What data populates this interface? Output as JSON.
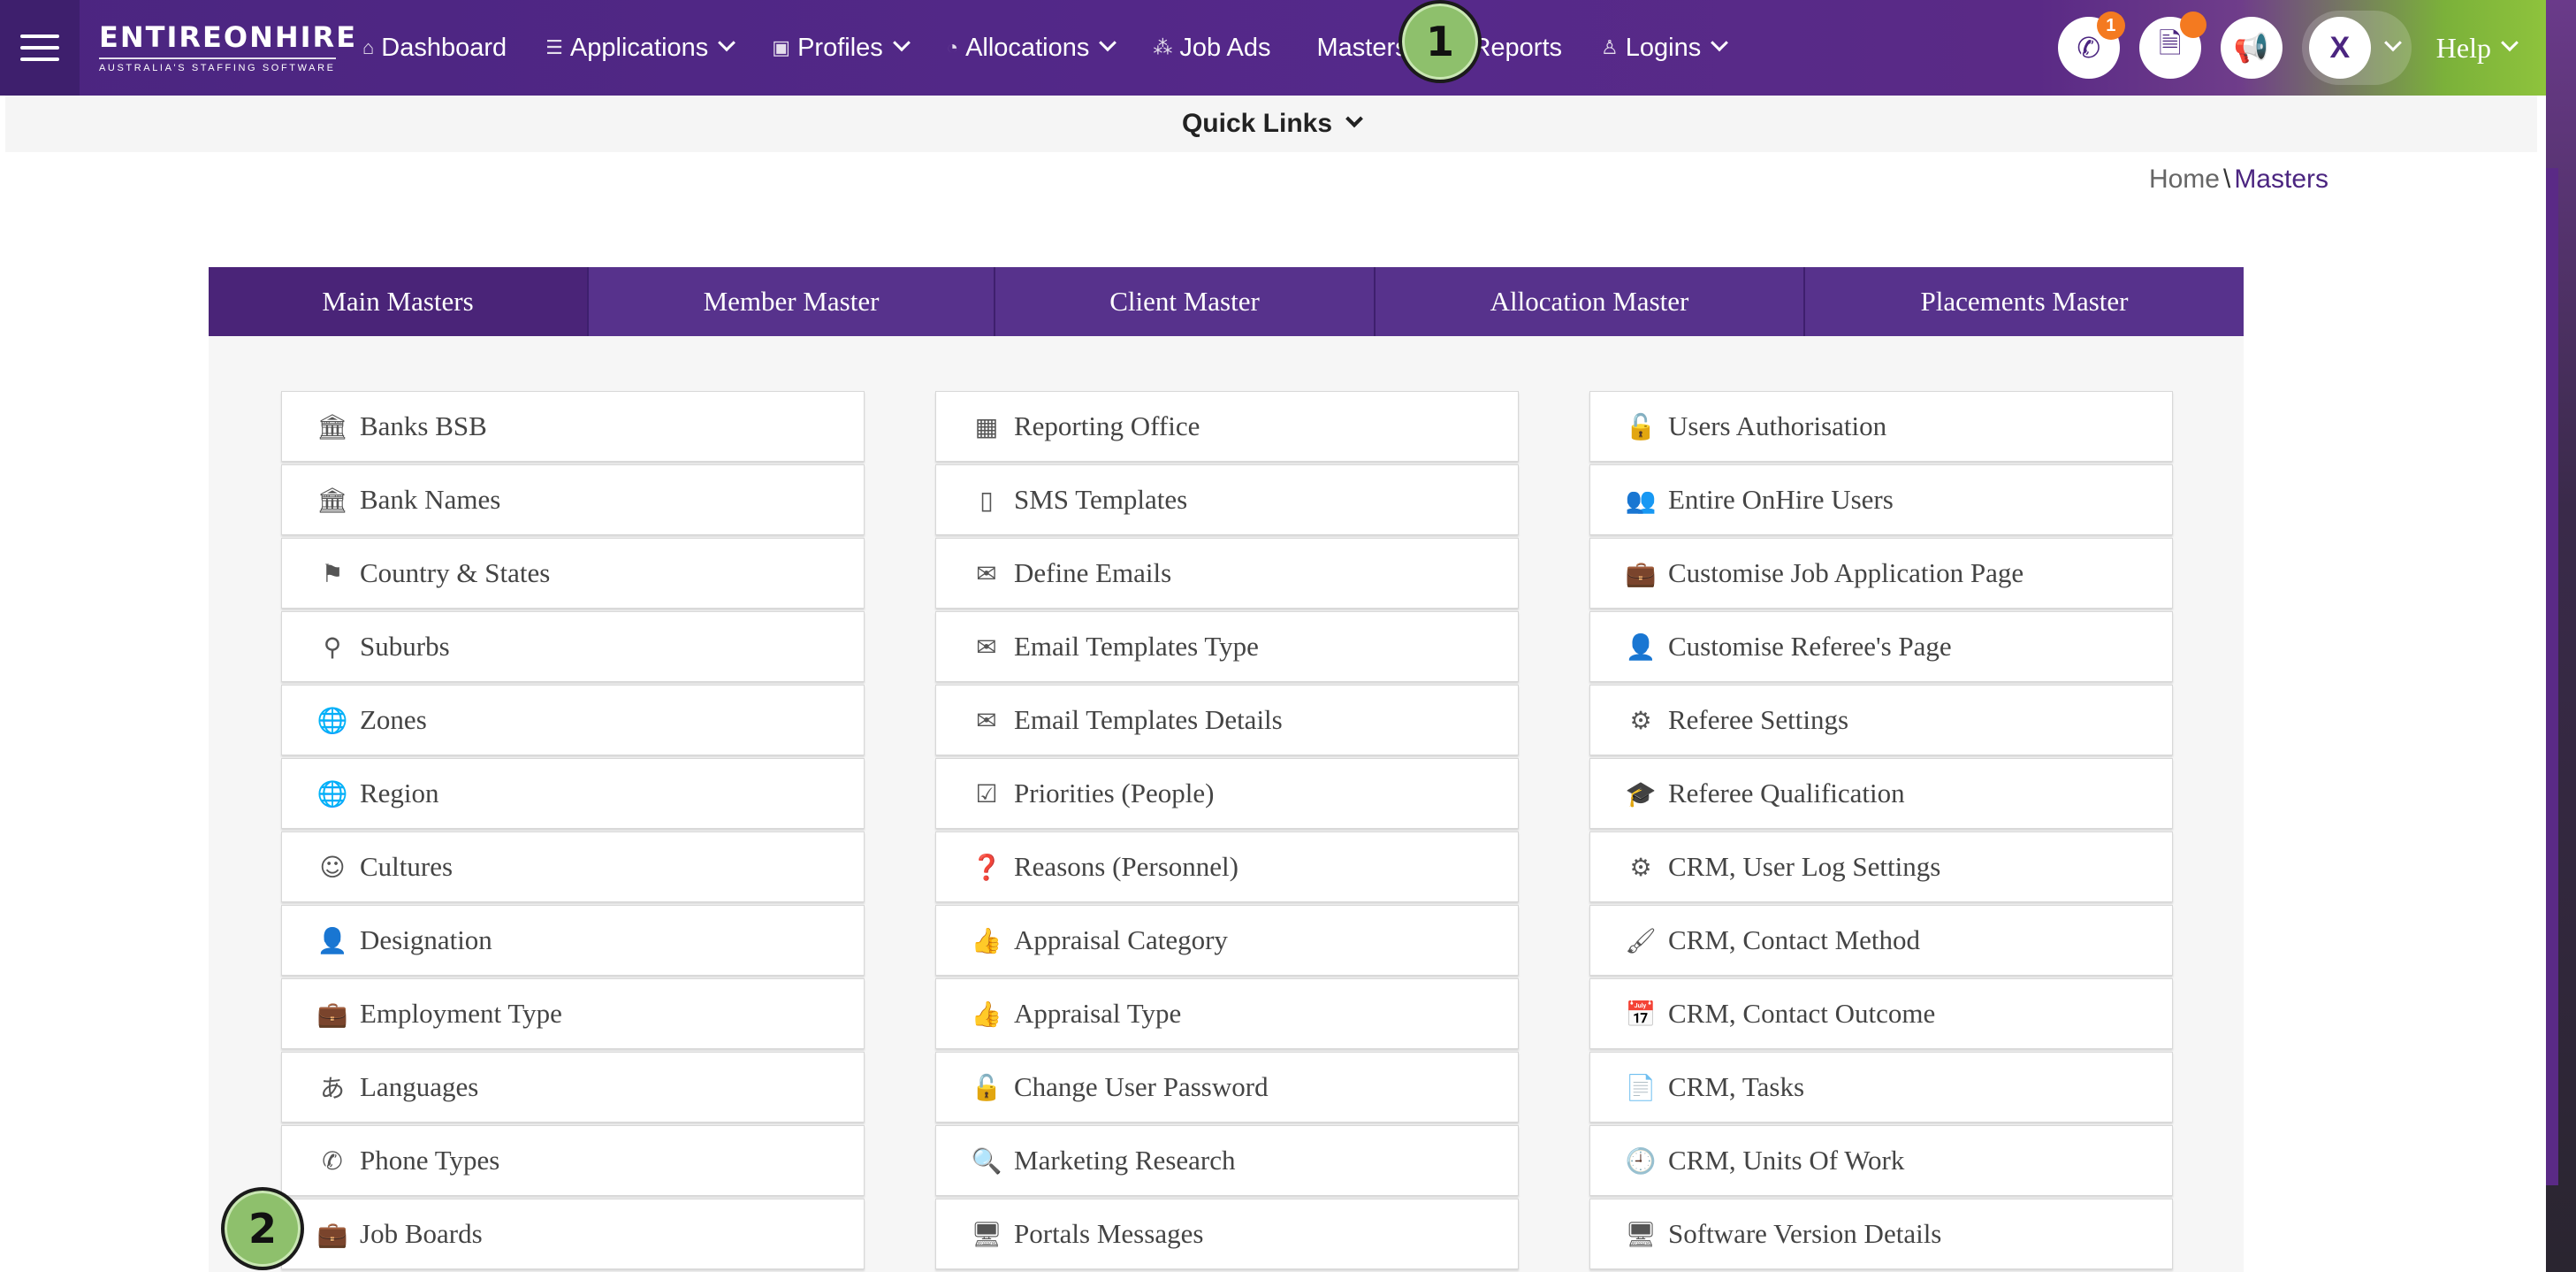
{
  "logo": {
    "main": "ENTIREONHIRE",
    "sub": "AUSTRALIA'S STAFFING SOFTWARE"
  },
  "nav": [
    {
      "label": "Dashboard",
      "icon": "home-icon",
      "glyph": "⌂",
      "dropdown": false
    },
    {
      "label": "Applications",
      "icon": "list-icon",
      "glyph": "☰",
      "dropdown": true
    },
    {
      "label": "Profiles",
      "icon": "id-card-icon",
      "glyph": "▣",
      "dropdown": true
    },
    {
      "label": "Allocations",
      "icon": "pie-chart-icon",
      "glyph": "◔",
      "dropdown": true
    },
    {
      "label": "Job Ads",
      "icon": "share-nodes-icon",
      "glyph": "⁂",
      "dropdown": false
    },
    {
      "label": "Masters",
      "icon": "masters-icon",
      "glyph": "",
      "dropdown": false
    },
    {
      "label": "Reports",
      "icon": "report-icon",
      "glyph": "▤",
      "dropdown": false
    },
    {
      "label": "Logins",
      "icon": "user-icon",
      "glyph": "♙",
      "dropdown": true
    }
  ],
  "toolbar": {
    "call_badge": "1",
    "user_initial": "X",
    "help_label": "Help"
  },
  "quick_links": "Quick Links",
  "breadcrumb": {
    "home": "Home",
    "separator": "\\",
    "current": "Masters"
  },
  "tabs": [
    "Main Masters",
    "Member Master",
    "Client Master",
    "Allocation Master",
    "Placements Master"
  ],
  "columns": [
    [
      {
        "label": "Banks BSB",
        "icon": "bank-icon",
        "glyph": "🏛"
      },
      {
        "label": "Bank Names",
        "icon": "bank-icon",
        "glyph": "🏛"
      },
      {
        "label": "Country & States",
        "icon": "flag-icon",
        "glyph": "⚑"
      },
      {
        "label": "Suburbs",
        "icon": "map-marker-icon",
        "glyph": "⚲"
      },
      {
        "label": "Zones",
        "icon": "globe-icon",
        "glyph": "🌐"
      },
      {
        "label": "Region",
        "icon": "globe-icon",
        "glyph": "🌐"
      },
      {
        "label": "Cultures",
        "icon": "smile-icon",
        "glyph": "☺"
      },
      {
        "label": "Designation",
        "icon": "user-icon",
        "glyph": "👤"
      },
      {
        "label": "Employment Type",
        "icon": "briefcase-icon",
        "glyph": "💼"
      },
      {
        "label": "Languages",
        "icon": "language-icon",
        "glyph": "あ"
      },
      {
        "label": "Phone Types",
        "icon": "phone-icon",
        "glyph": "✆"
      },
      {
        "label": "Job Boards",
        "icon": "briefcase-icon",
        "glyph": "💼"
      }
    ],
    [
      {
        "label": "Reporting Office",
        "icon": "building-icon",
        "glyph": "▦"
      },
      {
        "label": "SMS Templates",
        "icon": "mobile-icon",
        "glyph": "▯"
      },
      {
        "label": "Define Emails",
        "icon": "envelope-icon",
        "glyph": "✉"
      },
      {
        "label": "Email Templates Type",
        "icon": "envelope-icon",
        "glyph": "✉"
      },
      {
        "label": "Email Templates Details",
        "icon": "envelope-icon",
        "glyph": "✉"
      },
      {
        "label": "Priorities (People)",
        "icon": "checkbox-icon",
        "glyph": "☑"
      },
      {
        "label": "Reasons (Personnel)",
        "icon": "question-circle-icon",
        "glyph": "❓"
      },
      {
        "label": "Appraisal Category",
        "icon": "thumbs-up-icon",
        "glyph": "👍"
      },
      {
        "label": "Appraisal Type",
        "icon": "thumbs-up-icon",
        "glyph": "👍"
      },
      {
        "label": "Change User Password",
        "icon": "unlock-icon",
        "glyph": "🔓"
      },
      {
        "label": "Marketing Research",
        "icon": "search-icon",
        "glyph": "🔍"
      },
      {
        "label": "Portals Messages",
        "icon": "desktop-icon",
        "glyph": "🖥"
      }
    ],
    [
      {
        "label": "Users Authorisation",
        "icon": "lock-open-icon",
        "glyph": "🔓"
      },
      {
        "label": "Entire OnHire Users",
        "icon": "users-icon",
        "glyph": "👥"
      },
      {
        "label": "Customise Job Application Page",
        "icon": "briefcase-icon",
        "glyph": "💼"
      },
      {
        "label": "Customise Referee's Page",
        "icon": "user-plus-icon",
        "glyph": "👤"
      },
      {
        "label": "Referee Settings",
        "icon": "gears-icon",
        "glyph": "⚙"
      },
      {
        "label": "Referee Qualification",
        "icon": "graduation-cap-icon",
        "glyph": "🎓"
      },
      {
        "label": "CRM, User Log Settings",
        "icon": "gear-icon",
        "glyph": "⚙"
      },
      {
        "label": "CRM, Contact Method",
        "icon": "paint-brush-icon",
        "glyph": "🖌"
      },
      {
        "label": "CRM, Contact Outcome",
        "icon": "calendar-icon",
        "glyph": "📅"
      },
      {
        "label": "CRM, Tasks",
        "icon": "file-icon",
        "glyph": "📄"
      },
      {
        "label": "CRM, Units Of Work",
        "icon": "clock-icon",
        "glyph": "🕘"
      },
      {
        "label": "Software Version Details",
        "icon": "desktop-icon",
        "glyph": "🖥"
      }
    ]
  ],
  "markers": [
    "1",
    "2"
  ]
}
